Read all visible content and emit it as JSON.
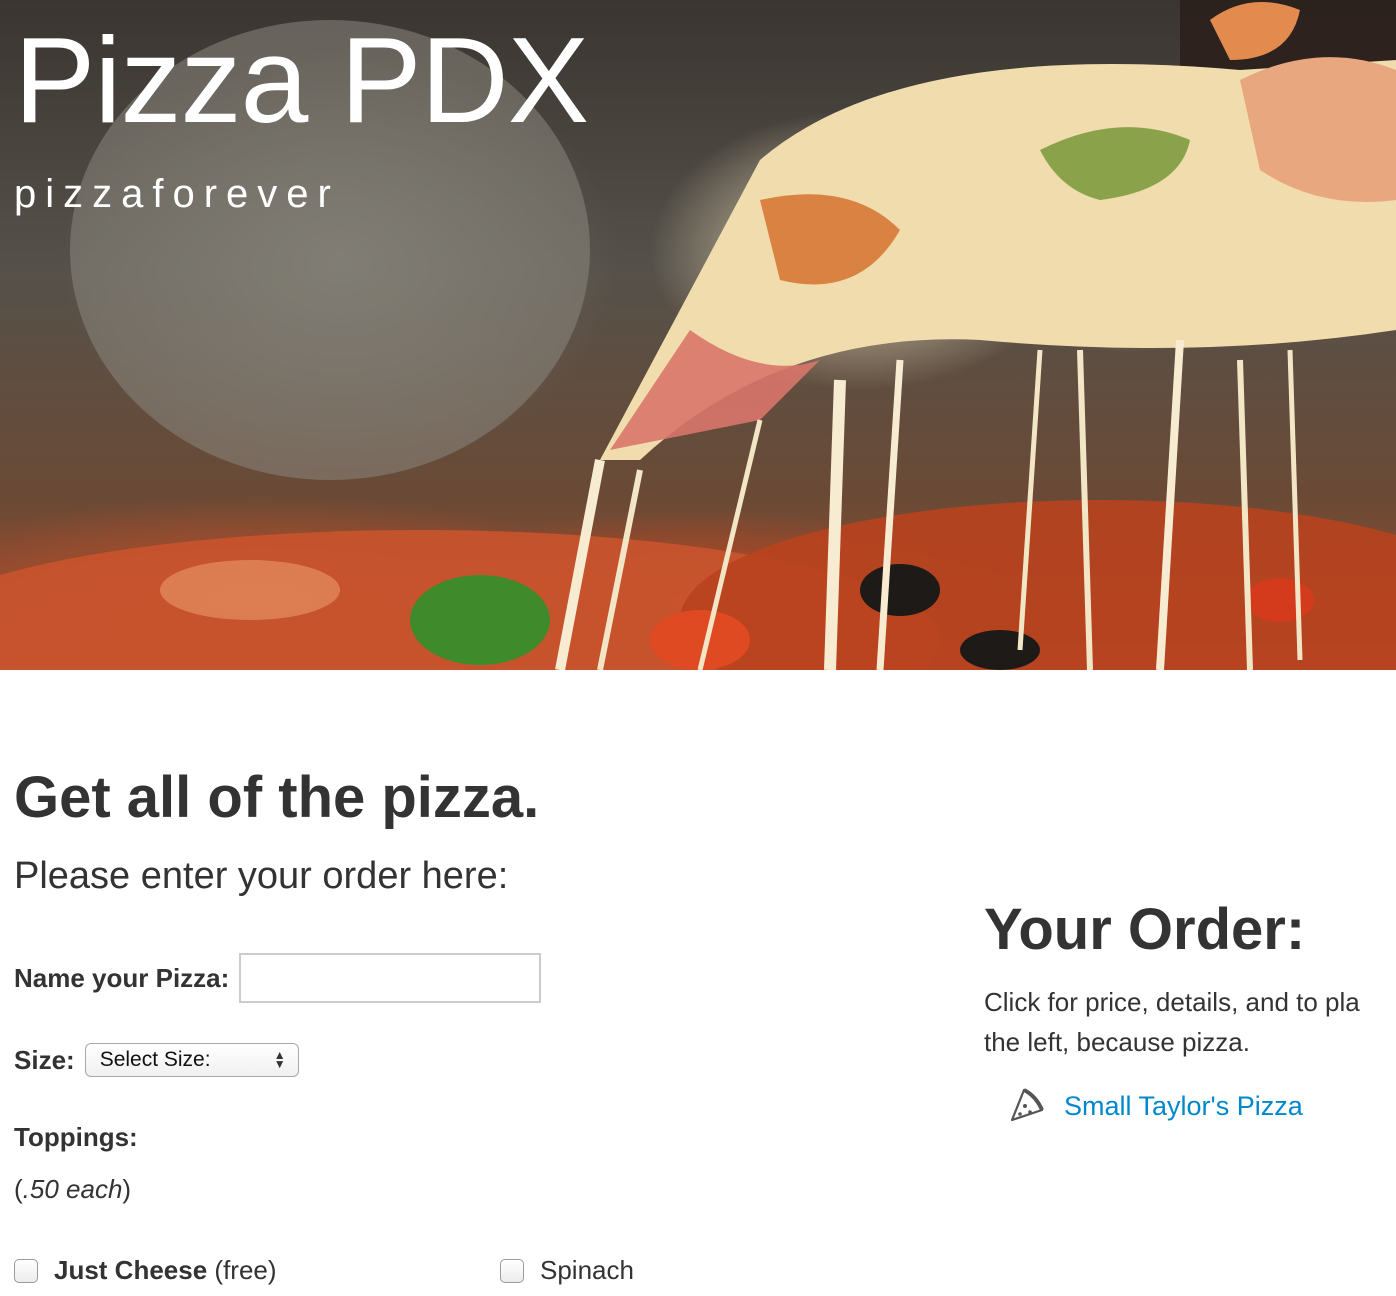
{
  "hero": {
    "title": "Pizza PDX",
    "tagline": "pizzaforever"
  },
  "form": {
    "heading": "Get all of the pizza.",
    "subheading": "Please enter your order here:",
    "name_label": "Name your Pizza:",
    "name_value": "",
    "size_label": "Size:",
    "size_selected": "Select Size:",
    "toppings_label": "Toppings:",
    "toppings_note_open": "(",
    "toppings_note_price": ".50 each",
    "toppings_note_close": ")",
    "toppings": [
      {
        "label": "Just Cheese",
        "note": "(free)",
        "checked": false
      },
      {
        "label": "Spinach",
        "note": "",
        "checked": false
      }
    ]
  },
  "order": {
    "heading": "Your Order:",
    "description": "Click for price, details, and to pla the left, because pizza.",
    "description_line1": "Click for price, details, and to pla",
    "description_line2": "the left, because pizza.",
    "items": [
      {
        "icon": "pizza-slice-icon",
        "label": "Small Taylor's Pizza"
      }
    ]
  },
  "colors": {
    "text": "#333333",
    "link": "#0088cc",
    "hero_text": "#ffffff",
    "input_border": "#cccccc"
  }
}
